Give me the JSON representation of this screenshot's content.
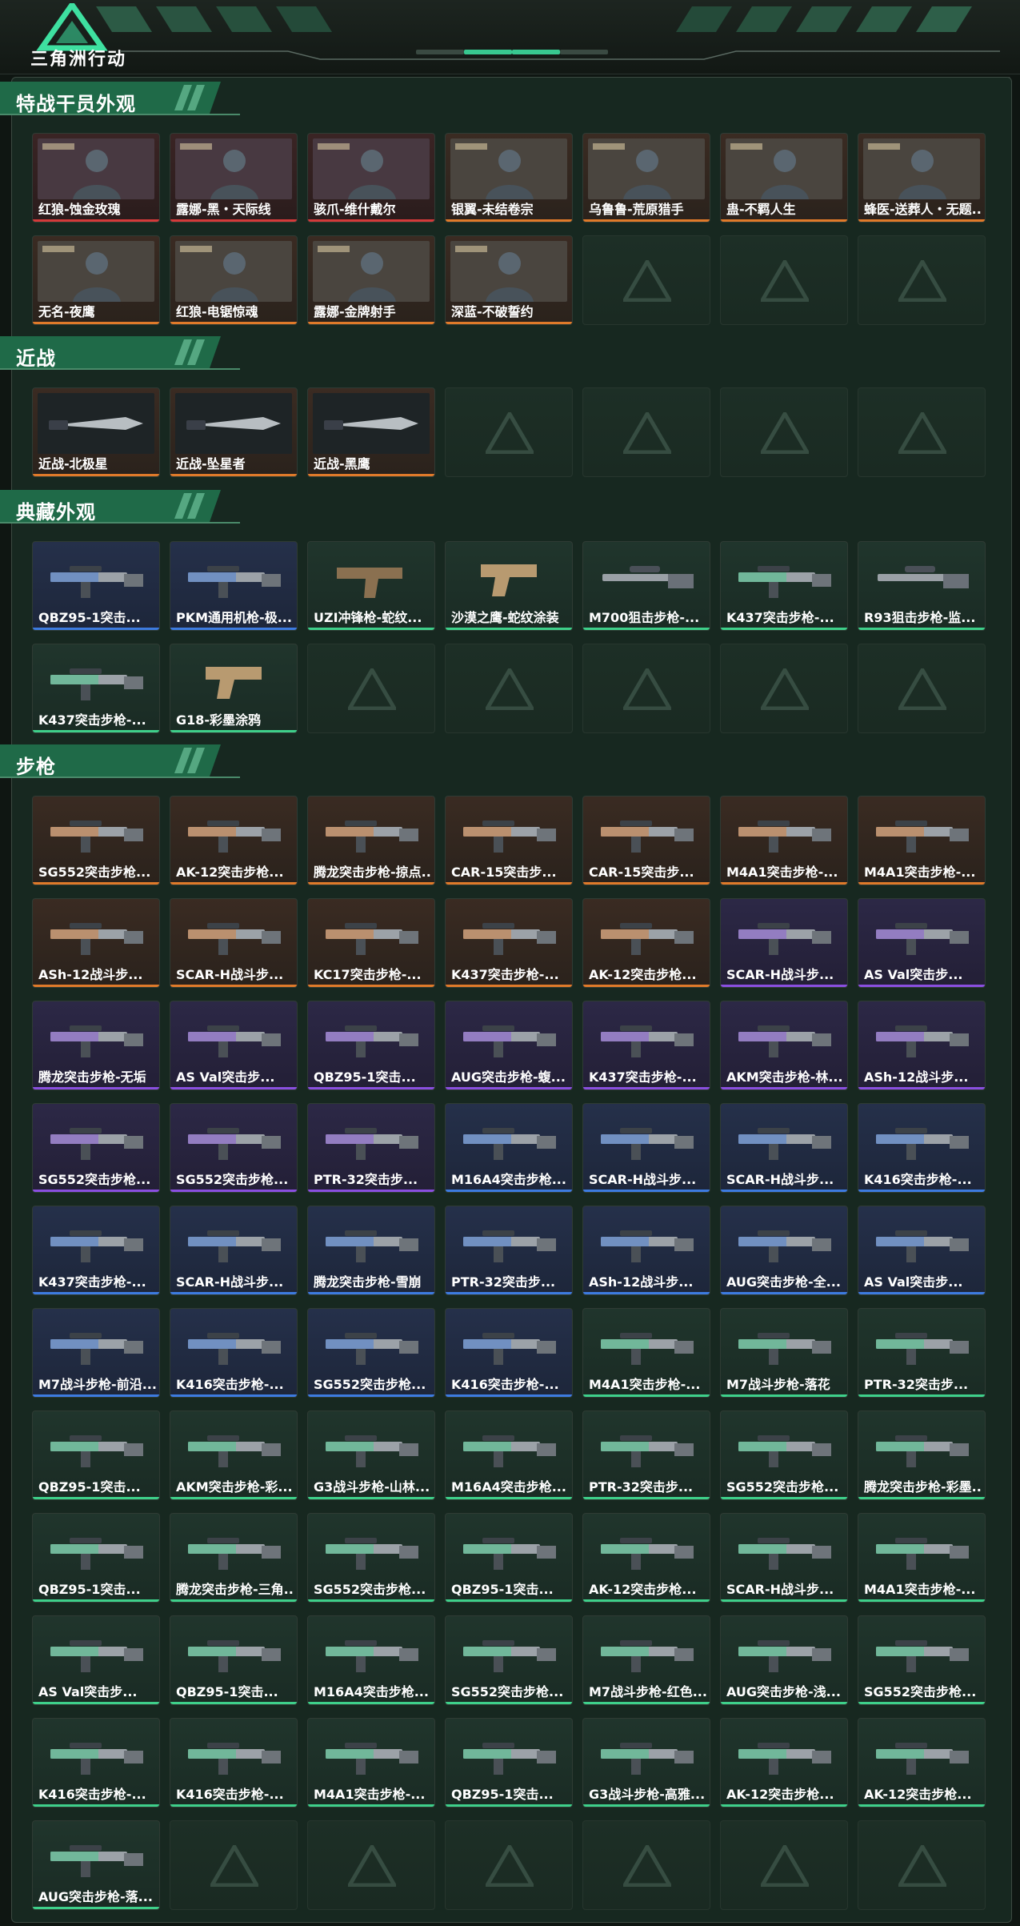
{
  "header": {
    "brand": "三角洲行动"
  },
  "sections": [
    {
      "title": "特战干员外观",
      "items": [
        {
          "name": "红狼-蚀金玫瑰",
          "rarity": "red",
          "icon": "operator-portrait"
        },
        {
          "name": "露娜-黑・天际线",
          "rarity": "red",
          "icon": "operator-portrait"
        },
        {
          "name": "骇爪-维什戴尔",
          "rarity": "red",
          "icon": "operator-portrait"
        },
        {
          "name": "银翼-未结卷宗",
          "rarity": "orange",
          "icon": "operator-portrait"
        },
        {
          "name": "乌鲁鲁-荒原猎手",
          "rarity": "orange",
          "icon": "operator-portrait"
        },
        {
          "name": "蛊-不羁人生",
          "rarity": "orange",
          "icon": "operator-portrait"
        },
        {
          "name": "蜂医-送葬人・无题...",
          "rarity": "orange",
          "icon": "operator-portrait"
        },
        {
          "name": "无名-夜鹰",
          "rarity": "orange",
          "icon": "operator-portrait"
        },
        {
          "name": "红狼-电锯惊魂",
          "rarity": "orange",
          "icon": "operator-portrait"
        },
        {
          "name": "露娜-金牌射手",
          "rarity": "orange",
          "icon": "operator-portrait"
        },
        {
          "name": "深蓝-不破誓约",
          "rarity": "orange",
          "icon": "operator-portrait"
        }
      ]
    },
    {
      "title": "近战",
      "items": [
        {
          "name": "近战-北极星",
          "rarity": "orange",
          "icon": "knife"
        },
        {
          "name": "近战-坠星者",
          "rarity": "orange",
          "icon": "knife"
        },
        {
          "name": "近战-黑鹰",
          "rarity": "orange",
          "icon": "knife"
        }
      ]
    },
    {
      "title": "典藏外观",
      "items": [
        {
          "name": "QBZ95-1突击...",
          "rarity": "blue",
          "icon": "rifle"
        },
        {
          "name": "PKM通用机枪-极...",
          "rarity": "blue",
          "icon": "rifle"
        },
        {
          "name": "UZI冲锋枪-蛇纹...",
          "rarity": "green",
          "icon": "smg"
        },
        {
          "name": "沙漠之鹰-蛇纹涂装",
          "rarity": "green",
          "icon": "pistol"
        },
        {
          "name": "M700狙击步枪-...",
          "rarity": "green",
          "icon": "sniper"
        },
        {
          "name": "K437突击步枪-...",
          "rarity": "green",
          "icon": "rifle"
        },
        {
          "name": "R93狙击步枪-监...",
          "rarity": "green",
          "icon": "sniper"
        },
        {
          "name": "K437突击步枪-...",
          "rarity": "green",
          "icon": "rifle"
        },
        {
          "name": "G18-彩墨涂鸦",
          "rarity": "green",
          "icon": "pistol"
        }
      ]
    },
    {
      "title": "步枪",
      "items": [
        {
          "name": "SG552突击步枪...",
          "rarity": "orange",
          "icon": "rifle"
        },
        {
          "name": "AK-12突击步枪...",
          "rarity": "orange",
          "icon": "rifle"
        },
        {
          "name": "腾龙突击步枪-掠点...",
          "rarity": "orange",
          "icon": "rifle"
        },
        {
          "name": "CAR-15突击步...",
          "rarity": "orange",
          "icon": "rifle"
        },
        {
          "name": "CAR-15突击步...",
          "rarity": "orange",
          "icon": "rifle"
        },
        {
          "name": "M4A1突击步枪-...",
          "rarity": "orange",
          "icon": "rifle"
        },
        {
          "name": "M4A1突击步枪-...",
          "rarity": "orange",
          "icon": "rifle"
        },
        {
          "name": "ASh-12战斗步...",
          "rarity": "orange",
          "icon": "rifle"
        },
        {
          "name": "SCAR-H战斗步...",
          "rarity": "orange",
          "icon": "rifle"
        },
        {
          "name": "KC17突击步枪-...",
          "rarity": "orange",
          "icon": "rifle"
        },
        {
          "name": "K437突击步枪-...",
          "rarity": "orange",
          "icon": "rifle"
        },
        {
          "name": "AK-12突击步枪...",
          "rarity": "orange",
          "icon": "rifle"
        },
        {
          "name": "SCAR-H战斗步...",
          "rarity": "purple",
          "icon": "rifle"
        },
        {
          "name": "AS Val突击步...",
          "rarity": "purple",
          "icon": "rifle"
        },
        {
          "name": "腾龙突击步枪-无垢",
          "rarity": "purple",
          "icon": "rifle"
        },
        {
          "name": "AS Val突击步...",
          "rarity": "purple",
          "icon": "rifle"
        },
        {
          "name": "QBZ95-1突击...",
          "rarity": "purple",
          "icon": "rifle"
        },
        {
          "name": "AUG突击步枪-蝮...",
          "rarity": "purple",
          "icon": "rifle"
        },
        {
          "name": "K437突击步枪-...",
          "rarity": "purple",
          "icon": "rifle"
        },
        {
          "name": "AKM突击步枪-林...",
          "rarity": "purple",
          "icon": "rifle"
        },
        {
          "name": "ASh-12战斗步...",
          "rarity": "purple",
          "icon": "rifle"
        },
        {
          "name": "SG552突击步枪...",
          "rarity": "purple",
          "icon": "rifle"
        },
        {
          "name": "SG552突击步枪...",
          "rarity": "purple",
          "icon": "rifle"
        },
        {
          "name": "PTR-32突击步...",
          "rarity": "purple",
          "icon": "rifle"
        },
        {
          "name": "M16A4突击步枪...",
          "rarity": "blue",
          "icon": "rifle"
        },
        {
          "name": "SCAR-H战斗步...",
          "rarity": "blue",
          "icon": "rifle"
        },
        {
          "name": "SCAR-H战斗步...",
          "rarity": "blue",
          "icon": "rifle"
        },
        {
          "name": "K416突击步枪-...",
          "rarity": "blue",
          "icon": "rifle"
        },
        {
          "name": "K437突击步枪-...",
          "rarity": "blue",
          "icon": "rifle"
        },
        {
          "name": "SCAR-H战斗步...",
          "rarity": "blue",
          "icon": "rifle"
        },
        {
          "name": "腾龙突击步枪-雪崩",
          "rarity": "blue",
          "icon": "rifle"
        },
        {
          "name": "PTR-32突击步...",
          "rarity": "blue",
          "icon": "rifle"
        },
        {
          "name": "ASh-12战斗步...",
          "rarity": "blue",
          "icon": "rifle"
        },
        {
          "name": "AUG突击步枪-全...",
          "rarity": "blue",
          "icon": "rifle"
        },
        {
          "name": "AS Val突击步...",
          "rarity": "blue",
          "icon": "rifle"
        },
        {
          "name": "M7战斗步枪-前沿...",
          "rarity": "blue",
          "icon": "rifle"
        },
        {
          "name": "K416突击步枪-...",
          "rarity": "blue",
          "icon": "rifle"
        },
        {
          "name": "SG552突击步枪...",
          "rarity": "blue",
          "icon": "rifle"
        },
        {
          "name": "K416突击步枪-...",
          "rarity": "blue",
          "icon": "rifle"
        },
        {
          "name": "M4A1突击步枪-...",
          "rarity": "green",
          "icon": "rifle"
        },
        {
          "name": "M7战斗步枪-落花",
          "rarity": "green",
          "icon": "rifle"
        },
        {
          "name": "PTR-32突击步...",
          "rarity": "green",
          "icon": "rifle"
        },
        {
          "name": "QBZ95-1突击...",
          "rarity": "green",
          "icon": "rifle"
        },
        {
          "name": "AKM突击步枪-彩...",
          "rarity": "green",
          "icon": "rifle"
        },
        {
          "name": "G3战斗步枪-山林...",
          "rarity": "green",
          "icon": "rifle"
        },
        {
          "name": "M16A4突击步枪...",
          "rarity": "green",
          "icon": "rifle"
        },
        {
          "name": "PTR-32突击步...",
          "rarity": "green",
          "icon": "rifle"
        },
        {
          "name": "SG552突击步枪...",
          "rarity": "green",
          "icon": "rifle"
        },
        {
          "name": "腾龙突击步枪-彩墨...",
          "rarity": "green",
          "icon": "rifle"
        },
        {
          "name": "QBZ95-1突击...",
          "rarity": "green",
          "icon": "rifle"
        },
        {
          "name": "腾龙突击步枪-三角...",
          "rarity": "green",
          "icon": "rifle"
        },
        {
          "name": "SG552突击步枪...",
          "rarity": "green",
          "icon": "rifle"
        },
        {
          "name": "QBZ95-1突击...",
          "rarity": "green",
          "icon": "rifle"
        },
        {
          "name": "AK-12突击步枪...",
          "rarity": "green",
          "icon": "rifle"
        },
        {
          "name": "SCAR-H战斗步...",
          "rarity": "green",
          "icon": "rifle"
        },
        {
          "name": "M4A1突击步枪-...",
          "rarity": "green",
          "icon": "rifle"
        },
        {
          "name": "AS Val突击步...",
          "rarity": "green",
          "icon": "rifle"
        },
        {
          "name": "QBZ95-1突击...",
          "rarity": "green",
          "icon": "rifle"
        },
        {
          "name": "M16A4突击步枪...",
          "rarity": "green",
          "icon": "rifle"
        },
        {
          "name": "SG552突击步枪...",
          "rarity": "green",
          "icon": "rifle"
        },
        {
          "name": "M7战斗步枪-红色...",
          "rarity": "green",
          "icon": "rifle"
        },
        {
          "name": "AUG突击步枪-浅...",
          "rarity": "green",
          "icon": "rifle"
        },
        {
          "name": "SG552突击步枪...",
          "rarity": "green",
          "icon": "rifle"
        },
        {
          "name": "K416突击步枪-...",
          "rarity": "green",
          "icon": "rifle"
        },
        {
          "name": "K416突击步枪-...",
          "rarity": "green",
          "icon": "rifle"
        },
        {
          "name": "M4A1突击步枪-...",
          "rarity": "green",
          "icon": "rifle"
        },
        {
          "name": "QBZ95-1突击...",
          "rarity": "green",
          "icon": "rifle"
        },
        {
          "name": "G3战斗步枪-高雅...",
          "rarity": "green",
          "icon": "rifle"
        },
        {
          "name": "AK-12突击步枪...",
          "rarity": "green",
          "icon": "rifle"
        },
        {
          "name": "AK-12突击步枪...",
          "rarity": "green",
          "icon": "rifle"
        },
        {
          "name": "AUG突击步枪-落...",
          "rarity": "green",
          "icon": "rifle"
        }
      ]
    }
  ],
  "colors": {
    "orange": "#e07a2a",
    "purple": "#8a4fe0",
    "blue": "#3d7be0",
    "green": "#3ed08a",
    "red": "#d43a3a",
    "accent": "#3ed08a"
  }
}
